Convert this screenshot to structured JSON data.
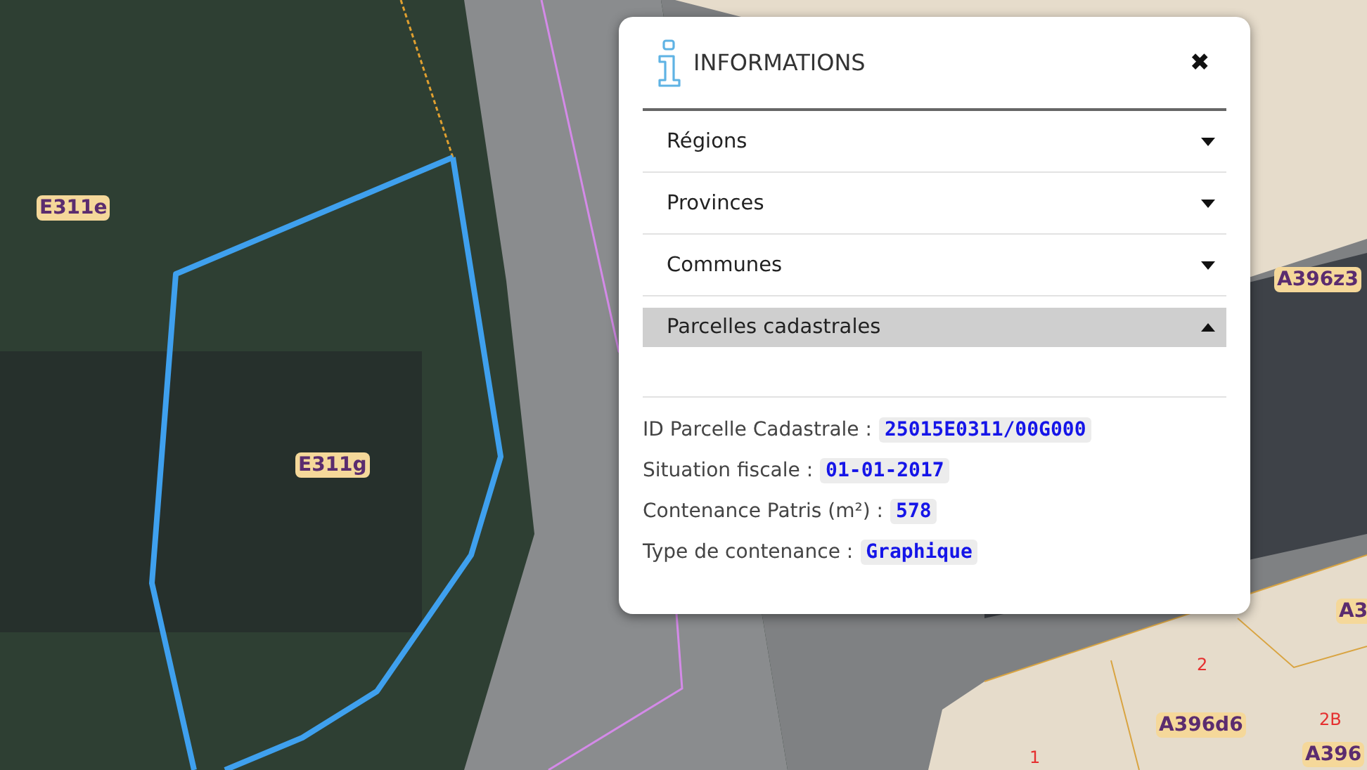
{
  "map": {
    "labels": [
      {
        "text": "E311e",
        "kind": "parcel"
      },
      {
        "text": "E311g",
        "kind": "parcel"
      },
      {
        "text": "A396z3",
        "kind": "parcel"
      },
      {
        "text": "A3",
        "kind": "parcel"
      },
      {
        "text": "2",
        "kind": "number"
      },
      {
        "text": "A396d6",
        "kind": "parcel"
      },
      {
        "text": "2B",
        "kind": "number"
      },
      {
        "text": "A396",
        "kind": "parcel"
      },
      {
        "text": "1",
        "kind": "number"
      }
    ]
  },
  "panel": {
    "title": "INFORMATIONS",
    "close": "✖",
    "sections": [
      {
        "label": "Régions",
        "expanded": false
      },
      {
        "label": "Provinces",
        "expanded": false
      },
      {
        "label": "Communes",
        "expanded": false
      },
      {
        "label": "Parcelles cadastrales",
        "expanded": true
      }
    ],
    "properties": [
      {
        "label": "ID Parcelle Cadastrale :",
        "value": "25015E0311/00G000"
      },
      {
        "label": "Situation fiscale :",
        "value": "01-01-2017"
      },
      {
        "label": "Contenance Patris (m²) :",
        "value": "578"
      },
      {
        "label": "Type de contenance :",
        "value": "Graphique"
      }
    ]
  }
}
